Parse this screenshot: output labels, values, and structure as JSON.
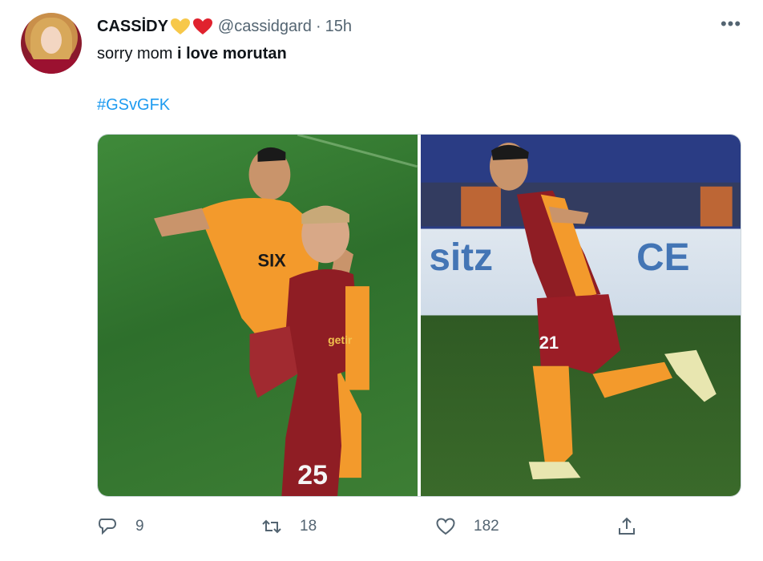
{
  "tweet": {
    "author_name": "CASSİDY",
    "handle": "@cassidgard",
    "separator": "·",
    "time": "15h",
    "more_label": "•••",
    "text_plain": "sorry mom ",
    "text_bold": "i love morutan",
    "hashtag": "#GSvGFK",
    "name_emojis": [
      "yellow-heart-icon",
      "red-heart-icon"
    ]
  },
  "media": {
    "images": [
      {
        "kit_text": "getir",
        "number": "25"
      },
      {
        "number": "21"
      }
    ]
  },
  "actions": {
    "reply_count": "9",
    "retweet_count": "18",
    "like_count": "182"
  },
  "colors": {
    "link": "#1d9bf0",
    "secondary_text": "#536471",
    "primary_text": "#0f1419"
  }
}
